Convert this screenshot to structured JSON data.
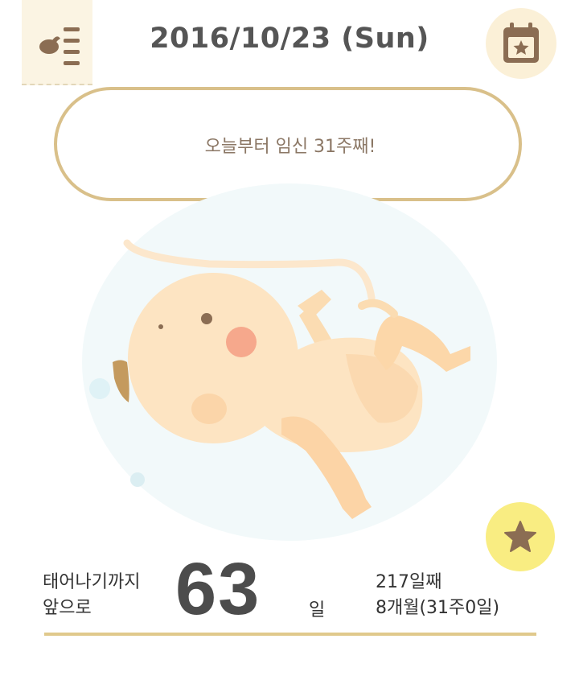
{
  "header": {
    "date": "2016/10/23 (Sun)",
    "menu_icon": "embryo-menu-icon",
    "calendar_icon": "calendar-star-icon"
  },
  "bubble": {
    "message": "오늘부터 임신 31주째!"
  },
  "illustration": {
    "subject": "fetus-illustration"
  },
  "favorite": {
    "icon": "star-icon"
  },
  "countdown": {
    "label_line1": "태어나기까지",
    "label_line2": "앞으로",
    "days": "63",
    "unit": "일",
    "day_count": "217일째",
    "month_week": "8개월(31주0일)"
  },
  "colors": {
    "accent_tan": "#d9c08a",
    "text_dark": "#555555",
    "bubble_text": "#8b7765",
    "icon_brown": "#8b6d53",
    "star_button": "#f9ed82"
  }
}
